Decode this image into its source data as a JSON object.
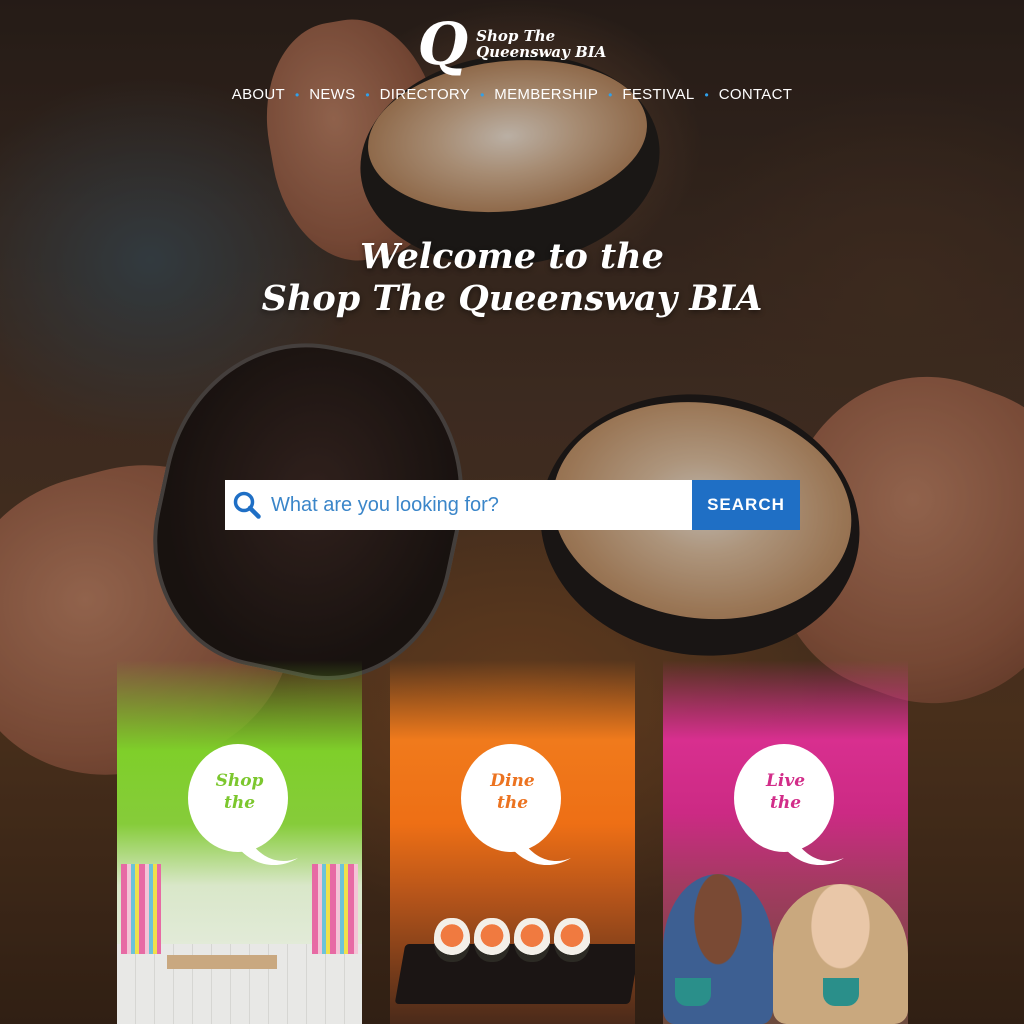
{
  "site": {
    "logo_letter": "Q",
    "logo_line1": "Shop The",
    "logo_line2": "Queensway BIA"
  },
  "nav": {
    "items": [
      {
        "label": "ABOUT"
      },
      {
        "label": "NEWS"
      },
      {
        "label": "DIRECTORY"
      },
      {
        "label": "MEMBERSHIP"
      },
      {
        "label": "FESTIVAL"
      },
      {
        "label": "CONTACT"
      }
    ]
  },
  "hero": {
    "title_line1": "Welcome to the",
    "title_line2": "Shop The Queensway BIA"
  },
  "search": {
    "placeholder": "What are you looking for?",
    "button_label": "SEARCH",
    "icon": "search-icon"
  },
  "tiles": [
    {
      "line1": "Shop",
      "line2": "the",
      "accent": "#7cc72e"
    },
    {
      "line1": "Dine",
      "line2": "the",
      "accent": "#ec7320"
    },
    {
      "line1": "Live",
      "line2": "the",
      "accent": "#d22d89"
    }
  ],
  "colors": {
    "nav_separator": "#2fa0ea",
    "search_button": "#1f6fc5",
    "search_text": "#3b86c9"
  }
}
